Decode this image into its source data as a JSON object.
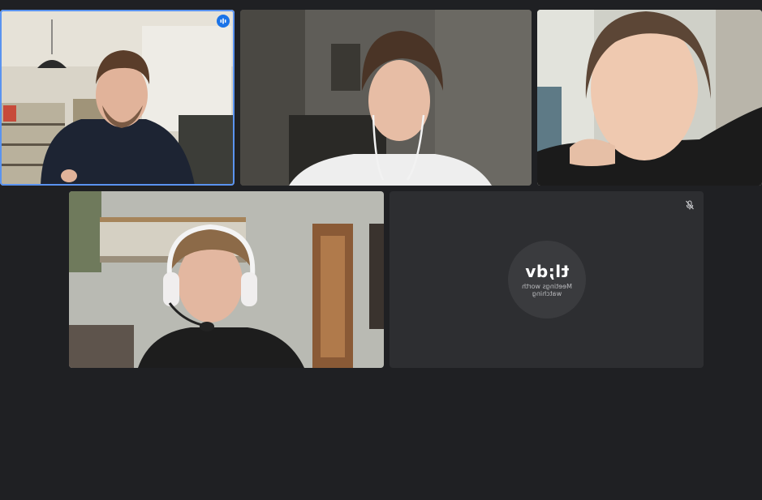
{
  "meeting": {
    "layout": "grid",
    "participant_count": 5
  },
  "participants": [
    {
      "id": "p1",
      "video_on": true,
      "active_speaker": true
    },
    {
      "id": "p2",
      "video_on": true,
      "active_speaker": false
    },
    {
      "id": "p3",
      "video_on": true,
      "active_speaker": false
    },
    {
      "id": "p4",
      "video_on": true,
      "active_speaker": false
    },
    {
      "id": "p5",
      "video_on": false,
      "muted": true,
      "avatar": {
        "logo": "tl;dv",
        "tagline": "Meetings worth watching"
      }
    }
  ],
  "icons": {
    "speaking": "audio-level-icon",
    "muted": "mic-off-icon"
  },
  "colors": {
    "background": "#1f2023",
    "tile": "#2b2c2f",
    "active_border": "#5a93f0",
    "speaking_badge": "#1a73e8"
  }
}
